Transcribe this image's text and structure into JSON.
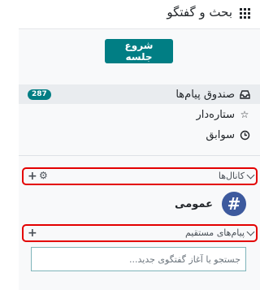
{
  "header": {
    "app_title": "بحث و گفتگو",
    "menu_icon": "apps-grid-icon"
  },
  "sidebar": {
    "start_button": "شروع جلسه",
    "items": [
      {
        "label": "صندوق پیام‌ها",
        "icon": "inbox-icon",
        "badge": "287",
        "active": true
      },
      {
        "label": "ستاره‌دار",
        "icon": "star-icon"
      },
      {
        "label": "سوابق",
        "icon": "history-icon"
      }
    ],
    "channels_section": {
      "label": "کانال‌ها",
      "icons": [
        "chevron-down-icon",
        "gear-icon",
        "plus-icon"
      ]
    },
    "channels": [
      {
        "name": "عمومی",
        "avatar": "#",
        "avatar_color": "#3d5a9e"
      }
    ],
    "direct_messages_section": {
      "label": "پیام‌های مستقیم",
      "icons": [
        "chevron-down-icon",
        "plus-icon"
      ]
    },
    "search": {
      "placeholder": "جستجو یا آغاز گفتگوی جدید...",
      "value": ""
    }
  },
  "colors": {
    "accent": "#017e84",
    "highlight_border": "#e30000",
    "channel_avatar": "#3d5a9e"
  }
}
